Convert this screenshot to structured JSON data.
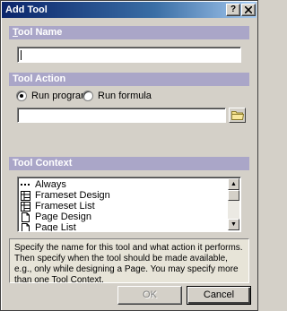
{
  "window": {
    "title": "Add Tool",
    "help_label": "?",
    "close_label": "X"
  },
  "tool_name": {
    "header": "Tool Name",
    "value": ""
  },
  "tool_action": {
    "header": "Tool Action",
    "run_program_label": "Run program",
    "run_formula_label": "Run formula",
    "selected": "Run program",
    "path_value": ""
  },
  "tool_context": {
    "header": "Tool Context",
    "items": [
      {
        "label": "Always",
        "icon": "ellipsis-icon"
      },
      {
        "label": "Frameset Design",
        "icon": "frameset-icon"
      },
      {
        "label": "Frameset List",
        "icon": "frameset-icon"
      },
      {
        "label": "Page Design",
        "icon": "page-icon"
      },
      {
        "label": "Page List",
        "icon": "page-icon"
      }
    ]
  },
  "help_text": "Specify the name for this tool and what action it performs.  Then specify when the tool should be made available, e.g., only while designing a Page. You may specify more than one Tool Context.",
  "buttons": {
    "ok": "OK",
    "cancel": "Cancel"
  },
  "colors": {
    "section_header": "#aaa6c8",
    "titlebar": "#0a246a"
  }
}
